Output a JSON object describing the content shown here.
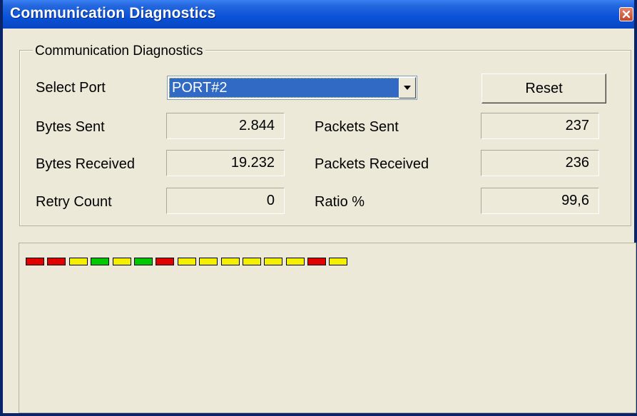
{
  "window": {
    "title": "Communication Diagnostics",
    "close_icon": "close-icon"
  },
  "group": {
    "legend": "Communication Diagnostics",
    "select_port_label": "Select Port",
    "port_selected": "PORT#2",
    "reset_label": "Reset",
    "bytes_sent_label": "Bytes Sent",
    "bytes_sent_value": "2.844",
    "bytes_received_label": "Bytes Received",
    "bytes_received_value": "19.232",
    "retry_count_label": "Retry Count",
    "retry_count_value": "0",
    "packets_sent_label": "Packets Sent",
    "packets_sent_value": "237",
    "packets_received_label": "Packets Received",
    "packets_received_value": "236",
    "ratio_label": "Ratio %",
    "ratio_value": "99,6"
  },
  "indicators": {
    "colors": {
      "red": "#E00000",
      "yellow": "#F5F000",
      "green": "#00C800"
    },
    "states": [
      "red",
      "red",
      "yellow",
      "green",
      "yellow",
      "green",
      "red",
      "yellow",
      "yellow",
      "yellow",
      "yellow",
      "yellow",
      "yellow",
      "red",
      "yellow"
    ]
  }
}
